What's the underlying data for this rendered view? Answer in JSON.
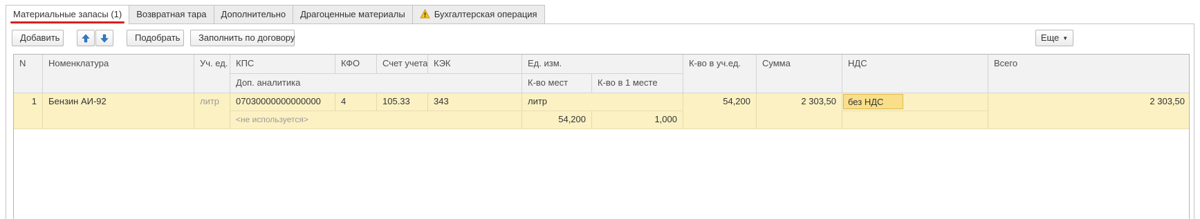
{
  "tabs": [
    {
      "label": "Материальные запасы (1)",
      "active": true
    },
    {
      "label": "Возвратная тара",
      "active": false
    },
    {
      "label": "Дополнительно",
      "active": false
    },
    {
      "label": "Драгоценные материалы",
      "active": false
    },
    {
      "label": "Бухгалтерская операция",
      "active": false,
      "icon": "warning-icon"
    }
  ],
  "toolbar": {
    "add_label": "Добавить",
    "move_up_icon": "arrow-up-icon",
    "move_down_icon": "arrow-down-icon",
    "select_label": "Подобрать",
    "fill_label": "Заполнить по договору",
    "more_label": "Еще"
  },
  "table": {
    "headers": {
      "n": "N",
      "nomenclature": "Номенклатура",
      "unit": "Уч. ед.",
      "kps": "КПС",
      "kfo": "КФО",
      "account": "Счет учета",
      "kek": "КЭК",
      "measure_unit": "Ед. изм.",
      "qty_acc_unit": "К-во в уч.ед.",
      "sum": "Сумма",
      "vat": "НДС",
      "total": "Всего",
      "extra_analytics": "Доп. аналитика",
      "places": "К-во мест",
      "qty_per_place": "К-во в 1 месте"
    },
    "rows": [
      {
        "n": "1",
        "nomenclature": "Бензин АИ-92",
        "unit": "литр",
        "kps": "07030000000000000",
        "kfo": "4",
        "account": "105.33",
        "kek": "343",
        "measure_unit": "литр",
        "qty_acc_unit": "54,200",
        "sum": "2 303,50",
        "vat": "без НДС",
        "total": "2 303,50",
        "extra_analytics": "<не используется>",
        "places": "54,200",
        "qty_per_place": "1,000"
      }
    ]
  },
  "colors": {
    "row_highlight": "#fcf1c3",
    "active_tab_underline": "#d41f1f",
    "arrow_blue": "#2e7bcf",
    "vat_cell_bg": "#f9df8a"
  }
}
